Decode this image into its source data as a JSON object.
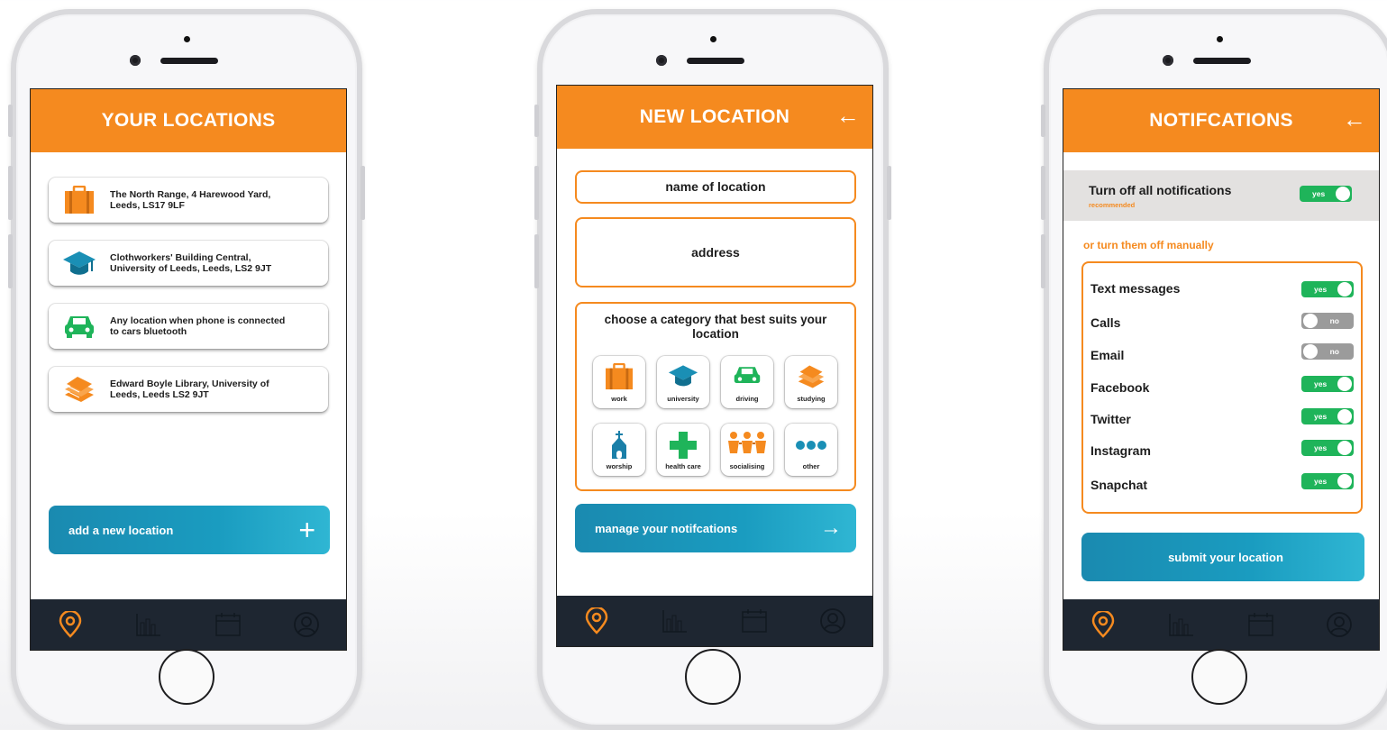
{
  "screens": {
    "locations": {
      "title": "YOUR LOCATIONS",
      "items": [
        {
          "icon": "briefcase-icon",
          "address": "The North Range, 4 Harewood Yard,\nLeeds, LS17 9LF"
        },
        {
          "icon": "graduation-cap-icon",
          "address": "Clothworkers' Building Central,\nUniversity of Leeds, Leeds, LS2 9JT"
        },
        {
          "icon": "car-icon",
          "address": "Any location when phone is connected\nto cars bluetooth"
        },
        {
          "icon": "books-icon",
          "address": "Edward Boyle Library, University of\nLeeds, Leeds LS2 9JT"
        }
      ],
      "add_button": "add a new location"
    },
    "new_location": {
      "title": "NEW LOCATION",
      "name_placeholder": "name of location",
      "address_placeholder": "address",
      "category_prompt": "choose a category that best suits your location",
      "categories": [
        {
          "label": "work",
          "icon": "briefcase-icon"
        },
        {
          "label": "university",
          "icon": "graduation-cap-icon"
        },
        {
          "label": "driving",
          "icon": "car-icon"
        },
        {
          "label": "studying",
          "icon": "books-icon"
        },
        {
          "label": "worship",
          "icon": "church-icon"
        },
        {
          "label": "health care",
          "icon": "medical-cross-icon"
        },
        {
          "label": "socialising",
          "icon": "people-icon"
        },
        {
          "label": "other",
          "icon": "dots-icon"
        }
      ],
      "manage_button": "manage your notifcations"
    },
    "notifications": {
      "title": "NOTIFCATIONS",
      "master_label": "Turn off all notifications",
      "master_sublabel": "recommended",
      "master_value": "yes",
      "manual_heading": "or turn them off manually",
      "items": [
        {
          "label": "Text messages",
          "value": "yes"
        },
        {
          "label": "Calls",
          "value": "no"
        },
        {
          "label": "Email",
          "value": "no"
        },
        {
          "label": "Facebook",
          "value": "yes"
        },
        {
          "label": "Twitter",
          "value": "yes"
        },
        {
          "label": "Instagram",
          "value": "yes"
        },
        {
          "label": "Snapchat",
          "value": "yes"
        }
      ],
      "submit_button": "submit your location"
    }
  },
  "back_arrow": "←",
  "plus_glyph": "+",
  "arrow_right": "→",
  "tabbar": [
    "location-pin-icon",
    "bar-chart-icon",
    "calendar-icon",
    "profile-icon"
  ],
  "colors": {
    "accent": "#f58a1f",
    "teal": "#1a9cc0",
    "toggle_on": "#1fb45a",
    "toggle_off": "#9b9b9b",
    "tabbar": "#1e2631"
  }
}
